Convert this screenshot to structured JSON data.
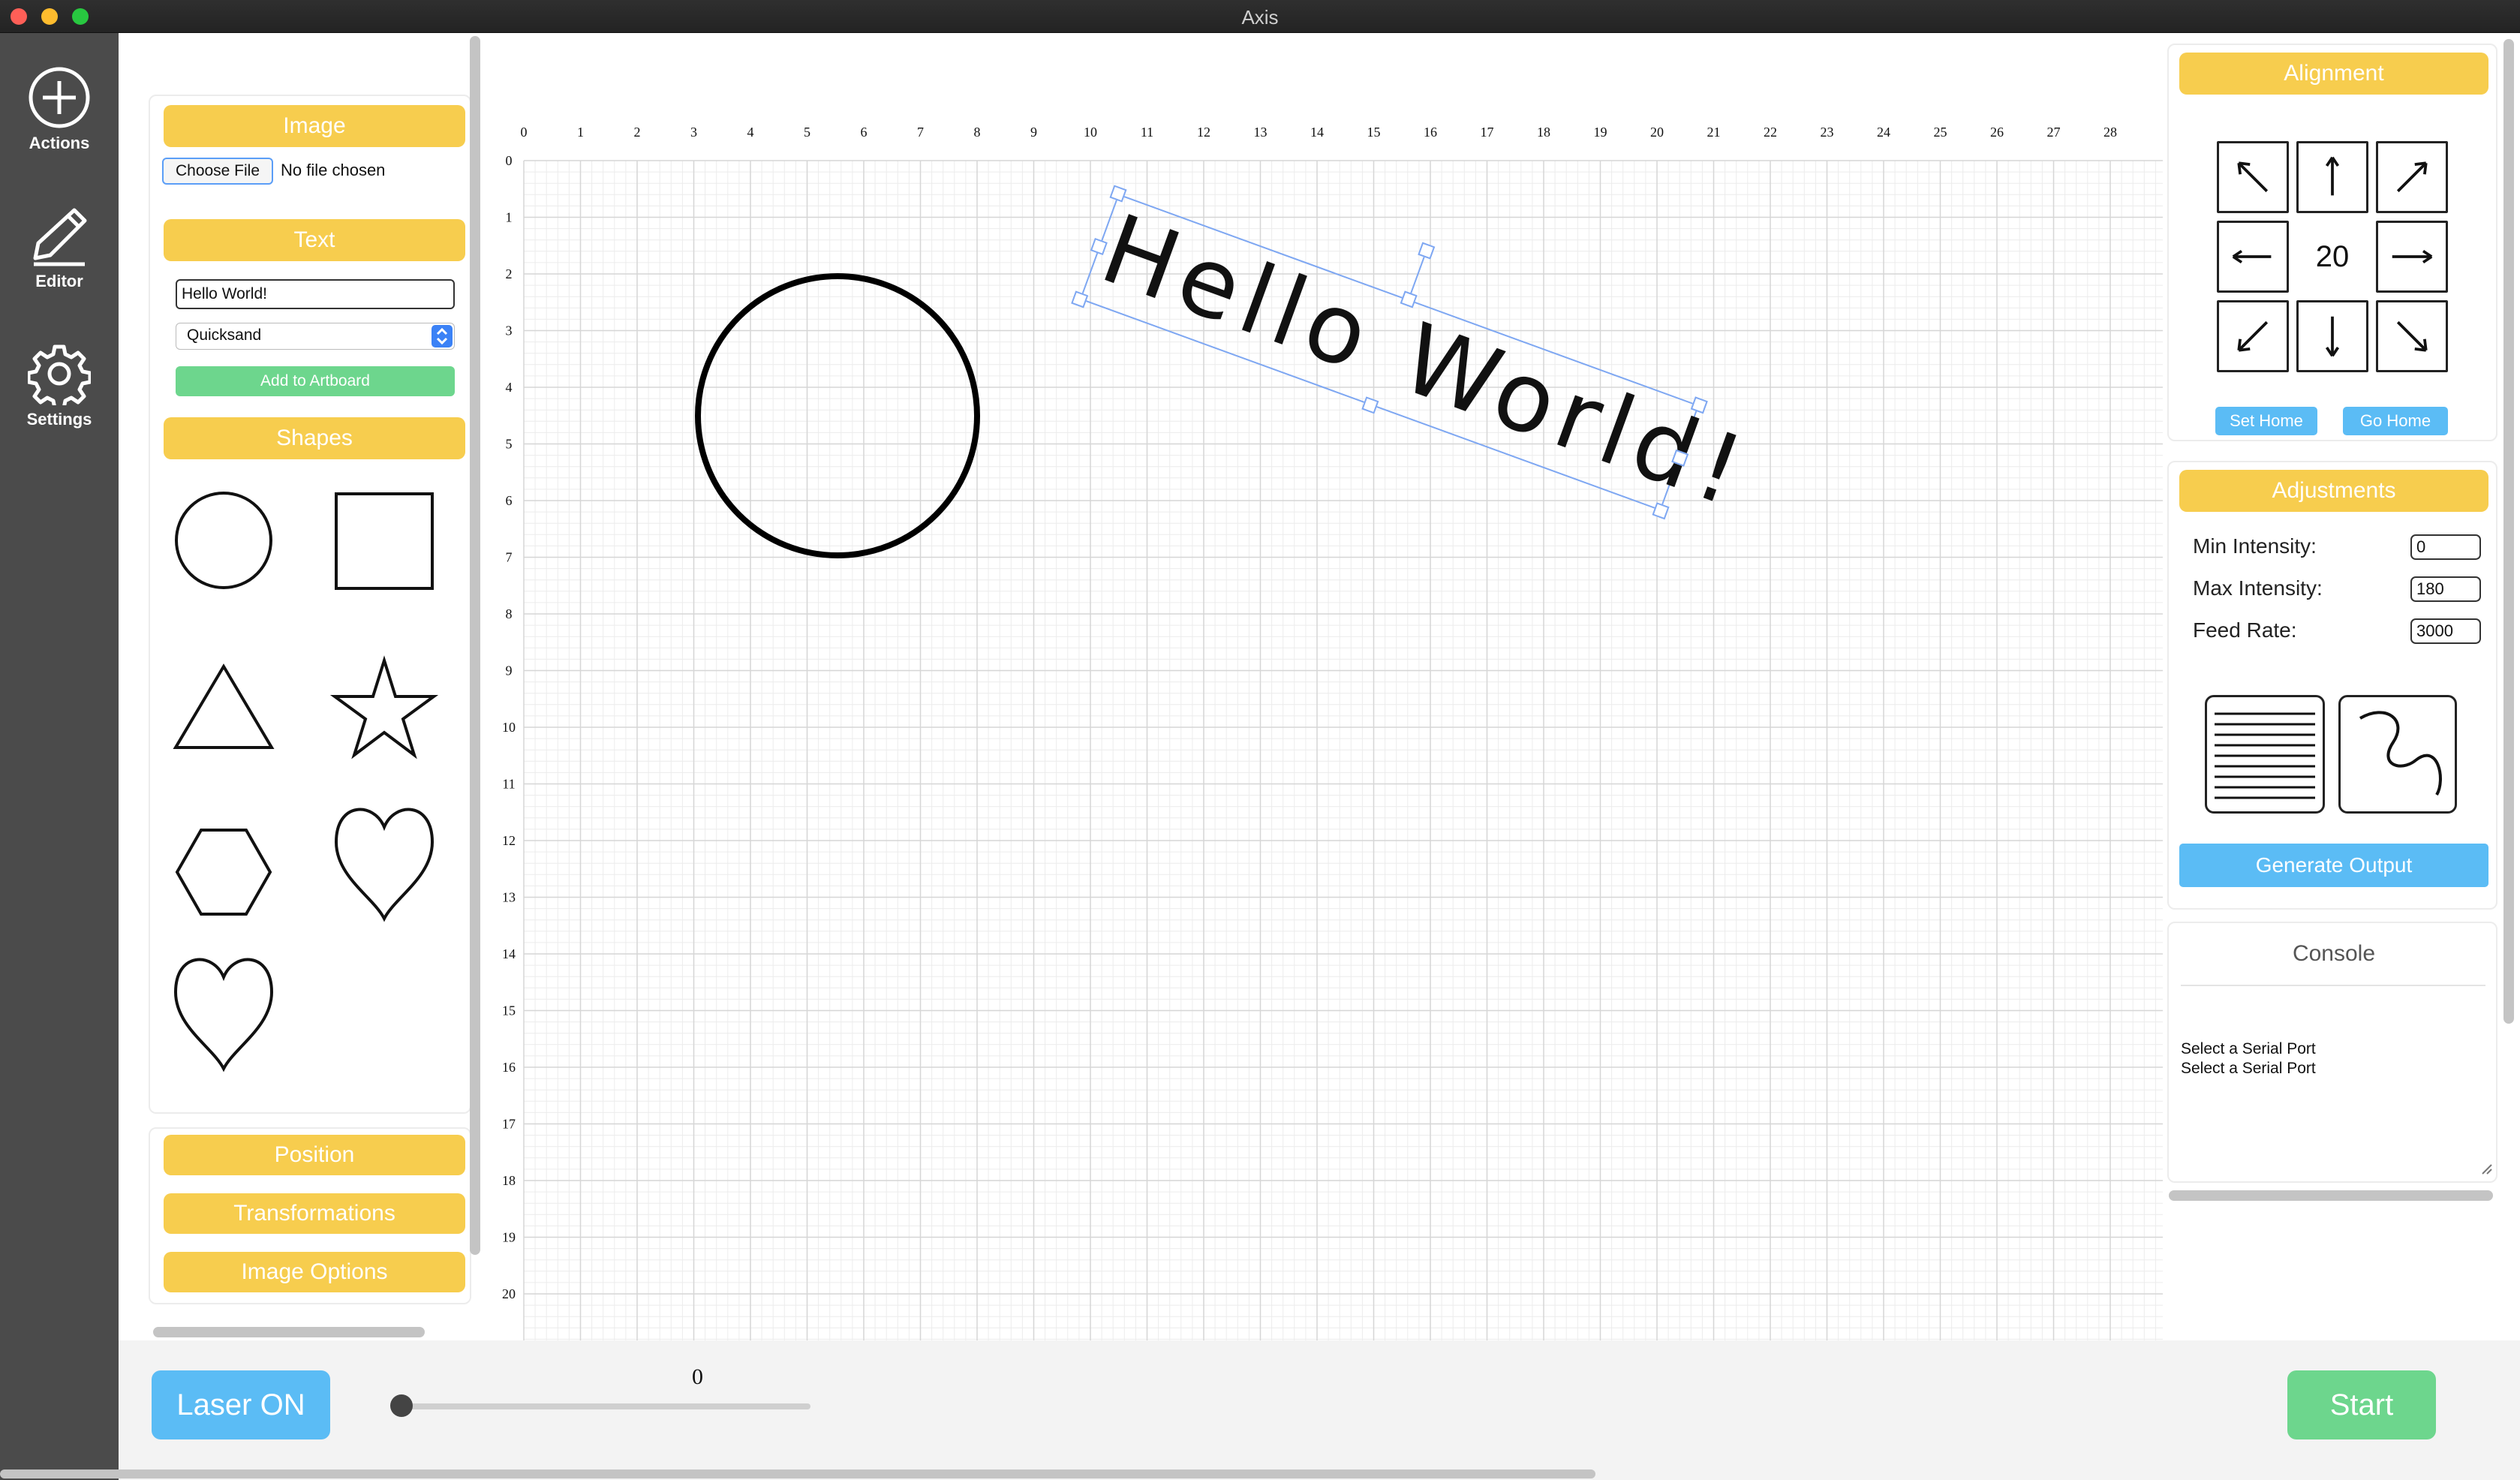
{
  "window": {
    "title": "Axis"
  },
  "nav": {
    "actions": "Actions",
    "editor": "Editor",
    "settings": "Settings"
  },
  "left_panel": {
    "image_header": "Image",
    "choose_file": "Choose File",
    "no_file": "No file chosen",
    "text_header": "Text",
    "text_value": "Hello World!",
    "font_value": "Quicksand",
    "add_to_artboard": "Add to Artboard",
    "shapes_header": "Shapes",
    "shapes": [
      "circle",
      "square",
      "triangle",
      "star",
      "hexagon",
      "heart",
      "heart"
    ],
    "position": "Position",
    "transformations": "Transformations",
    "image_options": "Image Options"
  },
  "artboard": {
    "x_ticks": [
      "0",
      "1",
      "2",
      "3",
      "4",
      "5",
      "6",
      "7",
      "8",
      "9",
      "10",
      "11",
      "12",
      "13",
      "14",
      "15",
      "16",
      "17",
      "18",
      "19",
      "20",
      "21",
      "22",
      "23",
      "24",
      "25",
      "26",
      "27",
      "28"
    ],
    "y_ticks": [
      "0",
      "1",
      "2",
      "3",
      "4",
      "5",
      "6",
      "7",
      "8",
      "9",
      "10",
      "11",
      "12",
      "13",
      "14",
      "15",
      "16",
      "17",
      "18",
      "19",
      "20"
    ],
    "text_object": "Hello World!"
  },
  "alignment": {
    "header": "Alignment",
    "step": "20",
    "set_home": "Set Home",
    "go_home": "Go Home"
  },
  "adjustments": {
    "header": "Adjustments",
    "min_intensity_label": "Min Intensity:",
    "min_intensity": "0",
    "max_intensity_label": "Max Intensity:",
    "max_intensity": "180",
    "feed_rate_label": "Feed Rate:",
    "feed_rate": "3000",
    "generate": "Generate Output"
  },
  "console": {
    "title": "Console",
    "lines": [
      "Select a Serial Port",
      "Select a Serial Port"
    ]
  },
  "bottom": {
    "laser_on": "Laser ON",
    "slider_value": "0",
    "start": "Start"
  },
  "colors": {
    "accent_yellow": "#f7cd4e",
    "accent_blue": "#5bbcf5",
    "accent_green": "#6dd68d",
    "sidebar": "#4b4b4b"
  }
}
